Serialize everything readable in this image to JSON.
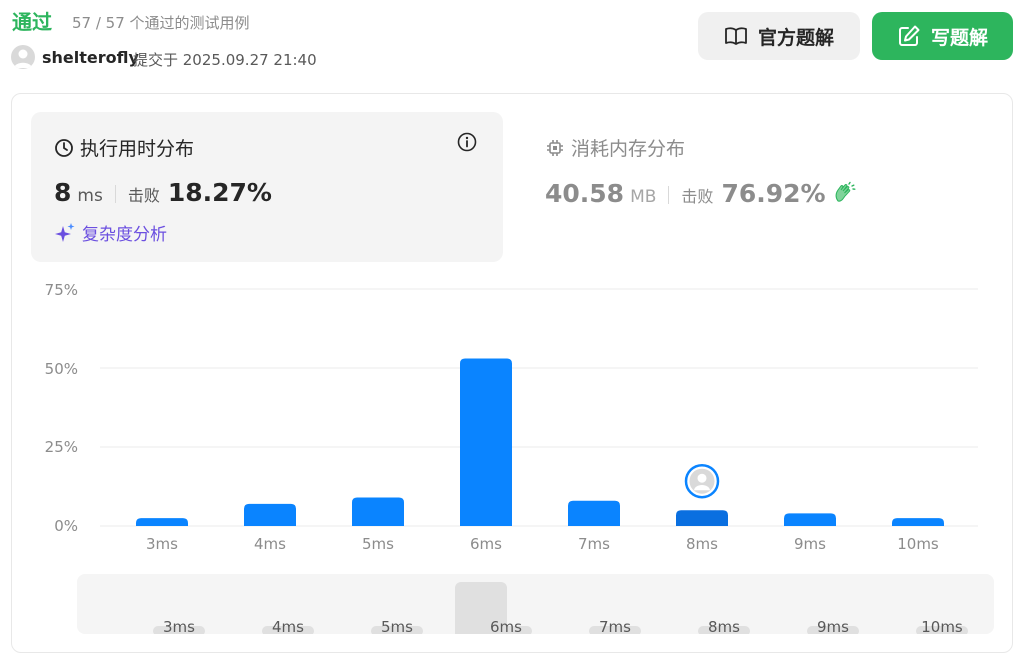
{
  "header": {
    "status": "通过",
    "passed_text": "57 / 57 个通过的测试用例",
    "username": "shelterofly",
    "submitted_text": "提交于 2025.09.27 21:40",
    "official_solution_label": "官方题解",
    "write_solution_label": "写题解"
  },
  "runtime": {
    "title": "执行用时分布",
    "value": "8",
    "unit": "ms",
    "beat_label": "击败",
    "beat_value": "18.27%",
    "complexity_label": "复杂度分析"
  },
  "memory": {
    "title": "消耗内存分布",
    "value": "40.58",
    "unit": "MB",
    "beat_label": "击败",
    "beat_value": "76.92%"
  },
  "chart_data": {
    "type": "bar",
    "categories": [
      "3ms",
      "4ms",
      "5ms",
      "6ms",
      "7ms",
      "8ms",
      "9ms",
      "10ms"
    ],
    "values": [
      2.5,
      7,
      9,
      53,
      8,
      5,
      4,
      2.5
    ],
    "y_tick_labels": [
      "75%",
      "50%",
      "25%",
      "0%"
    ],
    "ylim": [
      0,
      75
    ],
    "grid": true,
    "highlight_category": "8ms",
    "bar_color": "#0a84ff",
    "highlight_color": "#0a6fe0"
  },
  "colors": {
    "accent_green": "#2db55d",
    "complexity_purple": "#6b4fe0"
  }
}
